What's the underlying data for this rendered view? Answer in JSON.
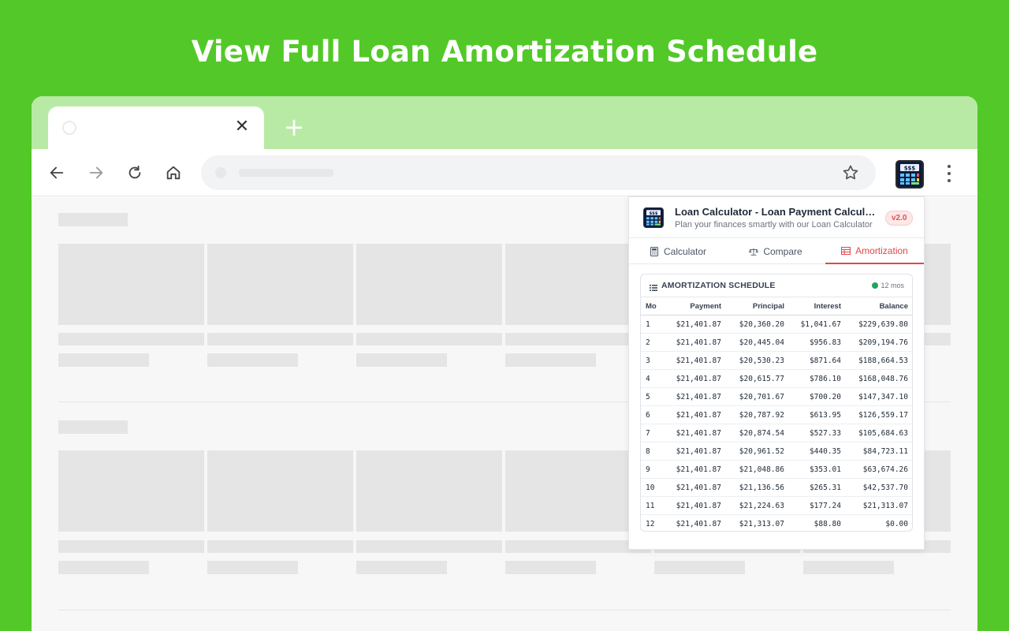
{
  "headline": "View Full Loan Amortization Schedule",
  "browser": {
    "tab_close_symbol": "✕",
    "new_tab_symbol": "+"
  },
  "popup": {
    "title": "Loan Calculator - Loan Payment Calculator",
    "subtitle": "Plan your finances smartly with our Loan Calculator",
    "version": "v2.0",
    "tabs": [
      {
        "label": "Calculator",
        "icon": "calculator-icon",
        "active": false
      },
      {
        "label": "Compare",
        "icon": "scale-icon",
        "active": false
      },
      {
        "label": "Amortization",
        "icon": "table-icon",
        "active": true
      }
    ],
    "schedule": {
      "title": "AMORTIZATION SCHEDULE",
      "count": "12 mos",
      "columns": [
        "Mo",
        "Payment",
        "Principal",
        "Interest",
        "Balance"
      ],
      "rows": [
        [
          "1",
          "$21,401.87",
          "$20,360.20",
          "$1,041.67",
          "$229,639.80"
        ],
        [
          "2",
          "$21,401.87",
          "$20,445.04",
          "$956.83",
          "$209,194.76"
        ],
        [
          "3",
          "$21,401.87",
          "$20,530.23",
          "$871.64",
          "$188,664.53"
        ],
        [
          "4",
          "$21,401.87",
          "$20,615.77",
          "$786.10",
          "$168,048.76"
        ],
        [
          "5",
          "$21,401.87",
          "$20,701.67",
          "$700.20",
          "$147,347.10"
        ],
        [
          "6",
          "$21,401.87",
          "$20,787.92",
          "$613.95",
          "$126,559.17"
        ],
        [
          "7",
          "$21,401.87",
          "$20,874.54",
          "$527.33",
          "$105,684.63"
        ],
        [
          "8",
          "$21,401.87",
          "$20,961.52",
          "$440.35",
          "$84,723.11"
        ],
        [
          "9",
          "$21,401.87",
          "$21,048.86",
          "$353.01",
          "$63,674.26"
        ],
        [
          "10",
          "$21,401.87",
          "$21,136.56",
          "$265.31",
          "$42,537.70"
        ],
        [
          "11",
          "$21,401.87",
          "$21,224.63",
          "$177.24",
          "$21,313.07"
        ],
        [
          "12",
          "$21,401.87",
          "$21,313.07",
          "$88.80",
          "$0.00"
        ]
      ]
    }
  },
  "colors": {
    "background": "#52c928",
    "accent": "#e04848",
    "tabstrip": "#b8eaa6"
  }
}
